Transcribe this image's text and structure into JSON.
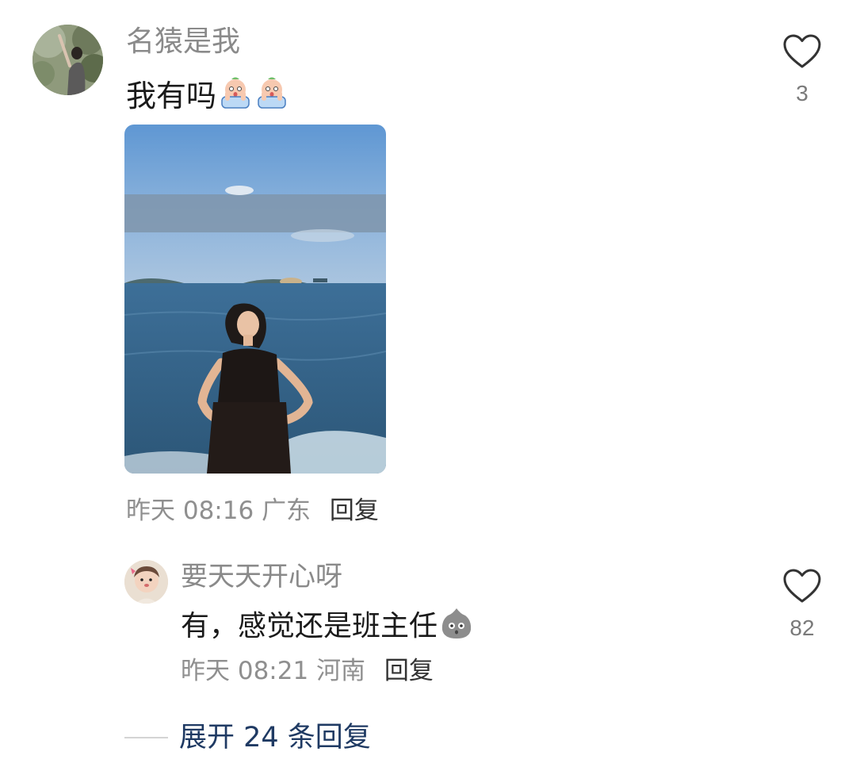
{
  "comment": {
    "username": "名猿是我",
    "text": "我有吗",
    "emojis": [
      "face-with-hands-emoji",
      "face-with-hands-emoji"
    ],
    "time": "昨天 08:16",
    "location": "广东",
    "reply_label": "回复",
    "like_count": "3",
    "avatar_icon": "avatar-photo",
    "photo_icon": "seaside-portrait-photo"
  },
  "reply": {
    "username": "要天天开心呀",
    "text": "有，感觉还是班主任",
    "emoji": "grey-blob-emoji",
    "time": "昨天 08:21",
    "location": "河南",
    "reply_label": "回复",
    "like_count": "82",
    "avatar_icon": "avatar-photo"
  },
  "expand": {
    "label": "展开 24 条回复"
  },
  "colors": {
    "secondary_text": "#8f8f8f",
    "primary_text": "#1a1a1a",
    "link_text": "#1f3a63",
    "icon_stroke": "#333333"
  }
}
